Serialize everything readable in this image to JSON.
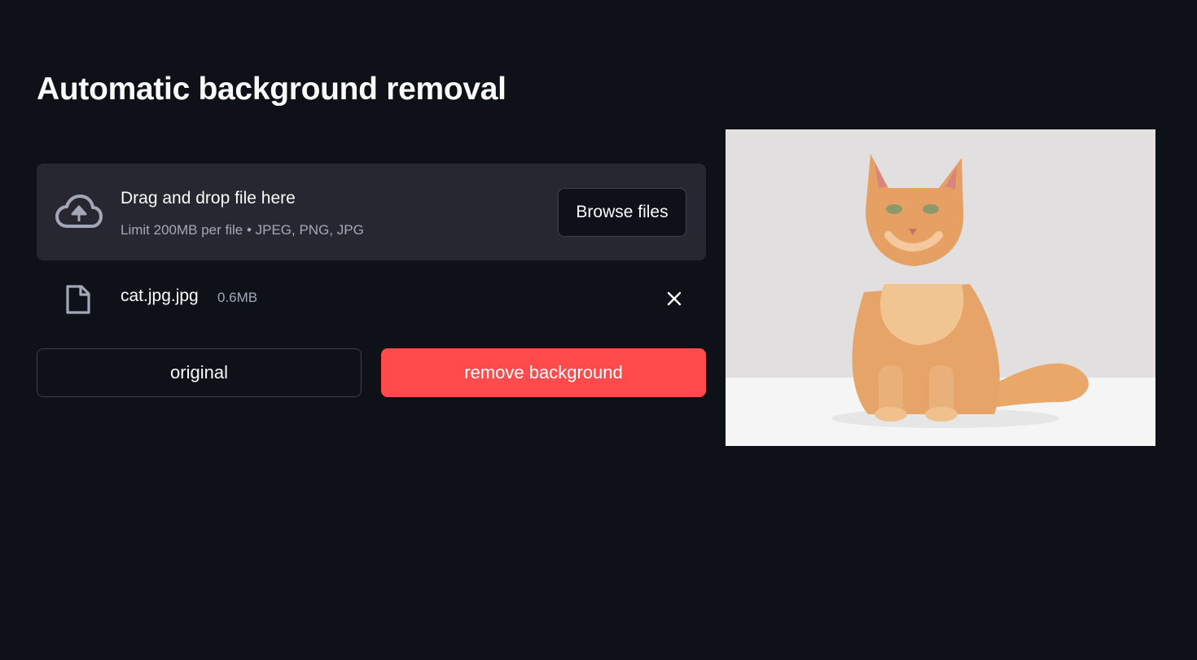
{
  "app": {
    "title": "Automatic background removal"
  },
  "uploader": {
    "drop_label": "Drag and drop file here",
    "limit_text": "Limit 200MB per file • JPEG, PNG, JPG",
    "browse_label": "Browse files",
    "icon": "cloud-upload-icon"
  },
  "uploaded_file": {
    "name": "cat.jpg.jpg",
    "size": "0.6MB",
    "icon": "file-icon",
    "remove_icon": "close-icon"
  },
  "actions": {
    "original_label": "original",
    "remove_bg_label": "remove background"
  },
  "preview": {
    "subject": "orange tabby cat sitting on white background"
  },
  "colors": {
    "background": "#0e1117",
    "panel": "#262730",
    "primary": "#ff4b4b",
    "text": "#fafafa",
    "muted": "#a3a8b8"
  }
}
